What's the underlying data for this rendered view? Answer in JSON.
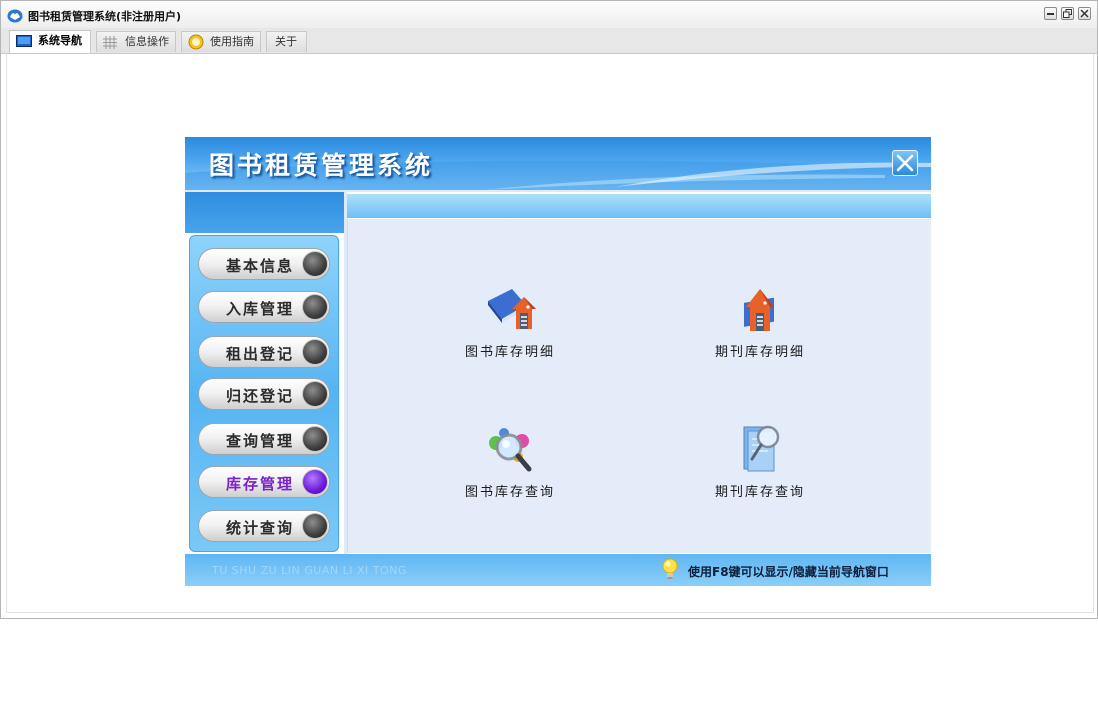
{
  "window": {
    "title": "图书租赁管理系统(非注册用户)",
    "controls": [
      "minimize",
      "restore",
      "close"
    ]
  },
  "tabs": [
    {
      "label": "系统导航",
      "icon": "monitor-icon",
      "active": true
    },
    {
      "label": "信息操作",
      "icon": "grid-icon",
      "active": false
    },
    {
      "label": "使用指南",
      "icon": "help-circle-icon",
      "active": false
    },
    {
      "label": "关于",
      "icon": "",
      "active": false
    }
  ],
  "panel": {
    "title": "图书租赁管理系统",
    "menu": [
      {
        "label": "基本信息",
        "active": false
      },
      {
        "label": "入库管理",
        "active": false
      },
      {
        "label": "租出登记",
        "active": false
      },
      {
        "label": "归还登记",
        "active": false
      },
      {
        "label": "查询管理",
        "active": false
      },
      {
        "label": "库存管理",
        "active": true
      },
      {
        "label": "统计查询",
        "active": false
      }
    ],
    "functions": [
      {
        "label": "图书库存明细",
        "icon": "book-house-icon"
      },
      {
        "label": "期刊库存明细",
        "icon": "journal-house-icon"
      },
      {
        "label": "图书库存查询",
        "icon": "magnifier-people-icon"
      },
      {
        "label": "期刊库存查询",
        "icon": "document-magnifier-icon"
      }
    ],
    "footer": {
      "watermark": "TU SHU ZU LIN  GUAN LI XI TONG",
      "tip": "使用F8键可以显示/隐藏当前导航窗口"
    }
  },
  "colors": {
    "header_blue": "#2a8ae0",
    "active_menu_purple": "#7a22c8",
    "body_bg": "#e4ecf9"
  }
}
